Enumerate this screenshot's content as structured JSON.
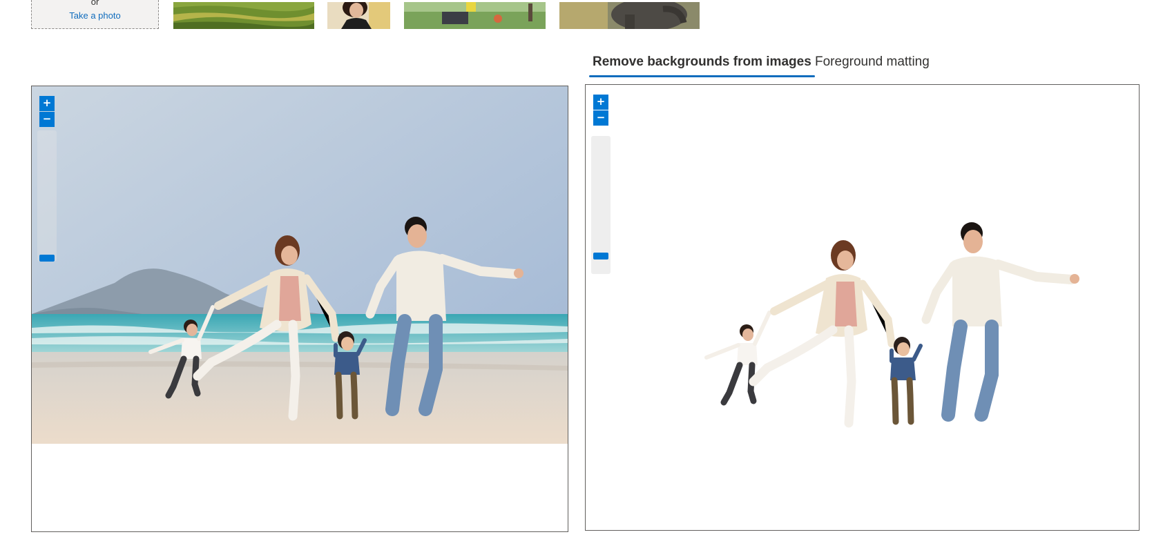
{
  "upload": {
    "or_text": "or",
    "take_photo_label": "Take a photo"
  },
  "samples": [
    {
      "name": "rice-terraces"
    },
    {
      "name": "woman-portrait"
    },
    {
      "name": "garden-scene"
    },
    {
      "name": "elephant"
    }
  ],
  "tabs": [
    {
      "label": "Remove backgrounds from images",
      "active": true
    },
    {
      "label": "Foreground matting",
      "active": false
    }
  ],
  "original_viewer": {
    "zoom_in_label": "+",
    "zoom_out_label": "−"
  },
  "result_viewer": {
    "zoom_in_label": "+",
    "zoom_out_label": "−"
  },
  "colors": {
    "accent": "#0078d4",
    "link": "#0f6cbd",
    "sky_top": "#a9bfda",
    "sea": "#5fb8c2",
    "sand": "#e6ddd0"
  },
  "icons": [
    "plus-icon",
    "minus-icon"
  ]
}
